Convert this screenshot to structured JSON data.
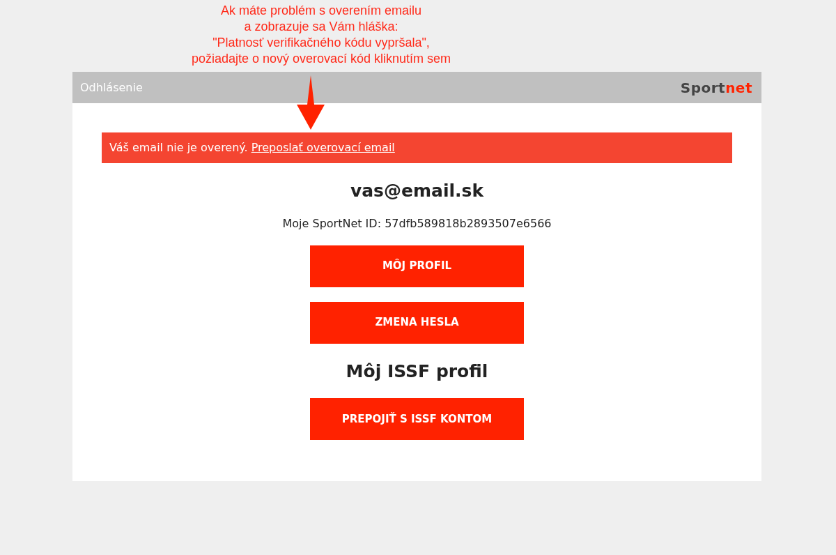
{
  "annotation": {
    "lines": [
      "Ak máte problém s overením emailu",
      "a zobrazuje sa Vám hláška:",
      "\"Platnosť verifikačného kódu vypršala\",",
      "požiadajte o nový overovací kód kliknutím sem"
    ]
  },
  "header": {
    "logout": "Odhlásenie",
    "logo": [
      "Sport",
      "net"
    ]
  },
  "alert": {
    "message": "Váš email nie je overený.",
    "link": "Preposlať overovací email"
  },
  "email": "vas@email.sk",
  "sportnet_id": "Moje SportNet ID: 57dfb589818b2893507e6566",
  "buttons": [
    "MÔJ PROFIL",
    "ZMENA HESLA"
  ],
  "issf": {
    "heading": "Môj ISSF profil",
    "button": "PREPOJIŤ S ISSF KONTOM"
  }
}
